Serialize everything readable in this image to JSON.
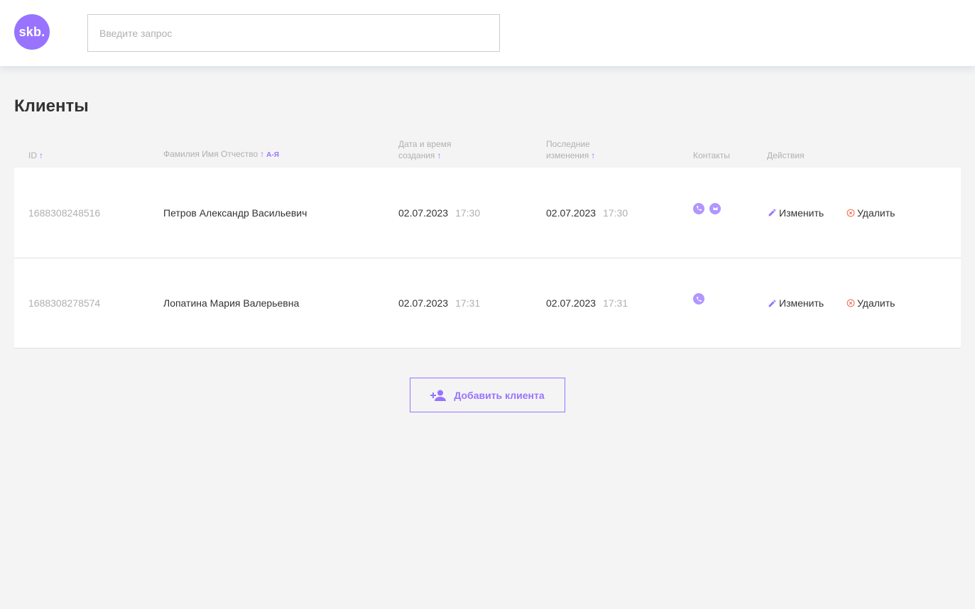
{
  "logo": {
    "text": "skb."
  },
  "search": {
    "placeholder": "Введите запрос"
  },
  "page": {
    "title": "Клиенты"
  },
  "table": {
    "headers": {
      "id": "ID",
      "name": "Фамилия Имя Отчество",
      "name_sort": "А-Я",
      "created_line1": "Дата и время",
      "created_line2": "создания",
      "changed_line1": "Последние",
      "changed_line2": "изменения",
      "contacts": "Контакты",
      "actions": "Действия"
    },
    "rows": [
      {
        "id": "1688308248516",
        "name": "Петров Александр Васильевич",
        "created_date": "02.07.2023",
        "created_time": "17:30",
        "changed_date": "02.07.2023",
        "changed_time": "17:30",
        "contacts": [
          "phone-icon",
          "mail-icon"
        ]
      },
      {
        "id": "1688308278574",
        "name": "Лопатина Мария Валерьевна",
        "created_date": "02.07.2023",
        "created_time": "17:31",
        "changed_date": "02.07.2023",
        "changed_time": "17:31",
        "contacts": [
          "phone-icon"
        ]
      }
    ],
    "actions": {
      "edit": "Изменить",
      "delete": "Удалить"
    }
  },
  "add_button": {
    "label": "Добавить клиента"
  },
  "colors": {
    "accent": "#9873ff",
    "danger": "#f06a4d",
    "muted": "#b0b0b0",
    "text": "#333333"
  }
}
